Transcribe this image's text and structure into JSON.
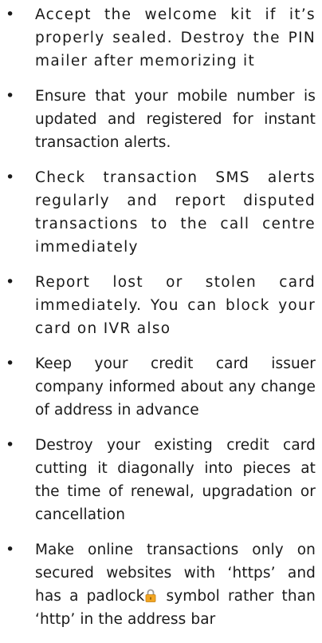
{
  "tips": [
    {
      "text": "Accept the welcome kit if it’s properly sealed. Destroy the PIN mailer after memorizing it",
      "style": "spaced"
    },
    {
      "text": "Ensure that your mobile number is updated and registered for instant transaction alerts.",
      "style": "normal"
    },
    {
      "text": "Check transaction SMS alerts regularly and report disputed transactions to the call centre immediately",
      "style": "spaced"
    },
    {
      "text": "Report lost or stolen card immediately. You can block your card on IVR also",
      "style": "spaced"
    },
    {
      "text": "Keep your credit card issuer company informed about any change of address in advance",
      "style": "normal"
    },
    {
      "text": "Destroy your existing credit card cutting it diagonally into pieces at the time of renewal, upgradation or cancellation",
      "style": "normal"
    }
  ],
  "last_tip": {
    "before_icon": "Make online transactions only on secured websites with ‘https’ and has a padlock",
    "icon": "padlock-icon",
    "after_icon": " symbol rather than ‘http’ in the address bar"
  },
  "colors": {
    "text": "#1a1a1a",
    "padlock_body": "#f2a623",
    "padlock_shackle": "#9a9a9a"
  }
}
